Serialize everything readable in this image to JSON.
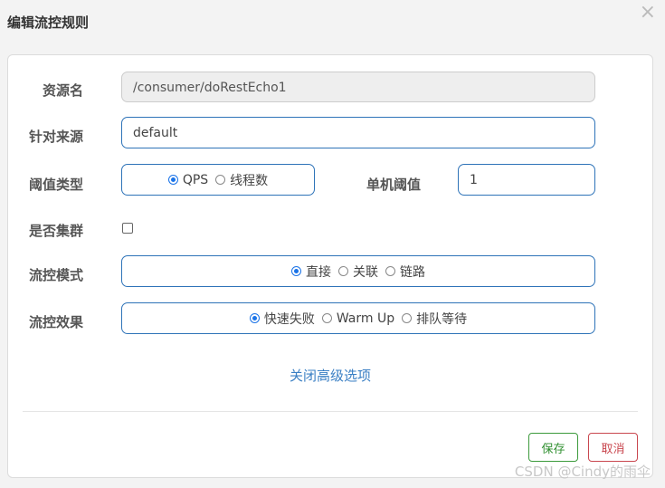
{
  "dialog": {
    "title": "编辑流控规则",
    "close_glyph": "×"
  },
  "form": {
    "resource": {
      "label": "资源名",
      "value": "/consumer/doRestEcho1"
    },
    "origin": {
      "label": "针对来源",
      "value": "default"
    },
    "threshold_type": {
      "label": "阈值类型",
      "options": [
        "QPS",
        "线程数"
      ],
      "selected": "QPS"
    },
    "threshold": {
      "label": "单机阈值",
      "value": "1"
    },
    "cluster": {
      "label": "是否集群",
      "checked": false
    },
    "flow_mode": {
      "label": "流控模式",
      "options": [
        "直接",
        "关联",
        "链路"
      ],
      "selected": "直接"
    },
    "flow_effect": {
      "label": "流控效果",
      "options": [
        "快速失败",
        "Warm Up",
        "排队等待"
      ],
      "selected": "快速失败"
    },
    "advanced_link": "关闭高级选项"
  },
  "buttons": {
    "save": "保存",
    "cancel": "取消"
  },
  "watermark": "CSDN @Cindy的雨伞",
  "colors": {
    "accent": "#2e73b8",
    "save": "#3c9a3c",
    "cancel": "#c9474f"
  }
}
